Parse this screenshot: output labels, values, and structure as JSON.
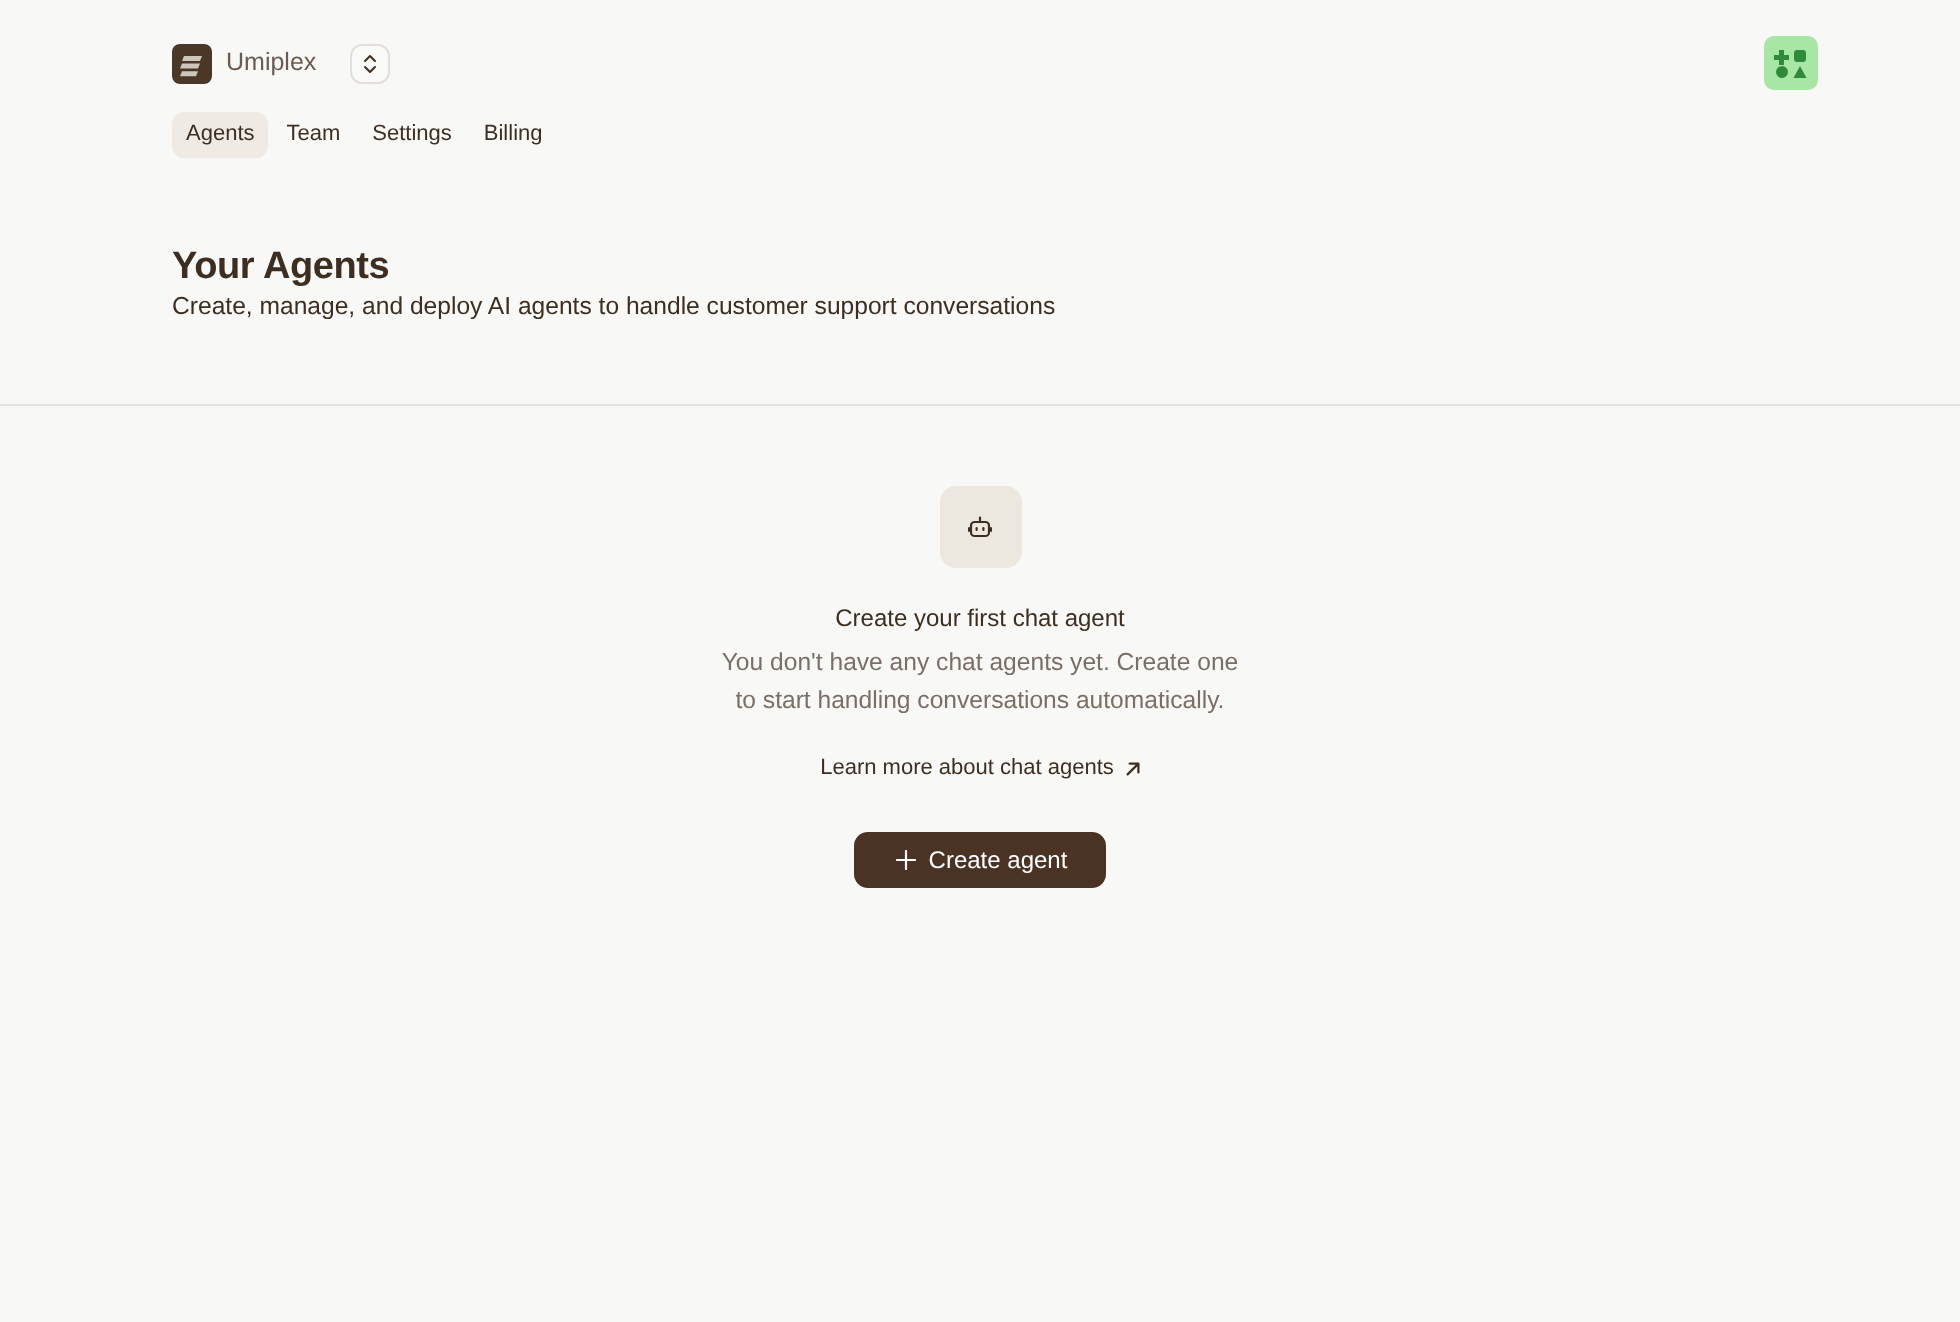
{
  "header": {
    "workspace": {
      "name": "Umiplex"
    },
    "tabs": [
      {
        "label": "Agents",
        "selected": true
      },
      {
        "label": "Team",
        "selected": false
      },
      {
        "label": "Settings",
        "selected": false
      },
      {
        "label": "Billing",
        "selected": false
      }
    ]
  },
  "page": {
    "title": "Your Agents",
    "subtitle": "Create, manage, and deploy AI agents to handle customer support conversations"
  },
  "empty_state": {
    "title": "Create your first chat agent",
    "description": "You don't have any chat agents yet. Create one to start handling conversations automatically.",
    "link": "Learn more about chat agents",
    "button": "Create agent"
  }
}
